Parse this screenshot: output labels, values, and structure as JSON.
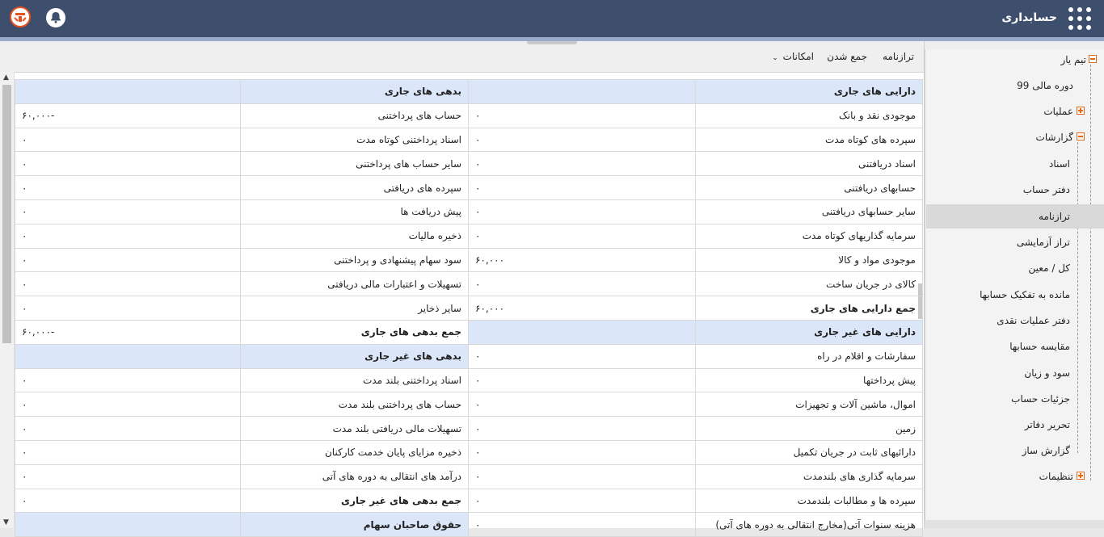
{
  "header": {
    "app_title": "حسابداری",
    "icons": [
      "apps-grid-icon",
      "bell-icon",
      "logo-icon"
    ]
  },
  "sidebar": {
    "items": [
      {
        "label": "تیم یار",
        "toggle": "minus"
      },
      {
        "label": "دوره مالی 99"
      },
      {
        "label": "عملیات",
        "toggle": "plus"
      },
      {
        "label": "گزارشات",
        "toggle": "minus"
      },
      {
        "label": "اسناد"
      },
      {
        "label": "دفتر حساب"
      },
      {
        "label": "ترازنامه",
        "active": true
      },
      {
        "label": "تراز آزمایشی"
      },
      {
        "label": "کل / معین"
      },
      {
        "label": "مانده به تفکیک حسابها"
      },
      {
        "label": "دفتر عملیات نقدی"
      },
      {
        "label": "مقایسه حسابها"
      },
      {
        "label": "سود و زیان"
      },
      {
        "label": "جزئیات حساب"
      },
      {
        "label": "تحریر دفاتر"
      },
      {
        "label": "گزارش ساز"
      },
      {
        "label": "تنظیمات",
        "toggle": "plus"
      }
    ]
  },
  "toolbar": {
    "title": "ترازنامه",
    "sum_label": "جمع شدن",
    "options_label": "امکانات"
  },
  "rows": [
    {
      "a_label": "دارایی های جاری",
      "a_value": "",
      "l_label": "بدهی های جاری",
      "l_value": "",
      "type": "header"
    },
    {
      "a_label": "موجودی نقد و بانک",
      "a_value": "۰",
      "l_label": "حساب های پرداختنی",
      "l_value": "-۶۰,۰۰۰"
    },
    {
      "a_label": "سپرده های کوتاه مدت",
      "a_value": "۰",
      "l_label": "اسناد پرداختنی کوتاه مدت",
      "l_value": "۰"
    },
    {
      "a_label": "اسناد دریافتنی",
      "a_value": "۰",
      "l_label": "سایر حساب های پرداختنی",
      "l_value": "۰"
    },
    {
      "a_label": "حسابهای دریافتنی",
      "a_value": "۰",
      "l_label": "سپرده های دریافتی",
      "l_value": "۰"
    },
    {
      "a_label": "سایر حسابهای دریافتنی",
      "a_value": "۰",
      "l_label": "پیش دریافت ها",
      "l_value": "۰"
    },
    {
      "a_label": "سرمایه گذاریهای کوتاه مدت",
      "a_value": "۰",
      "l_label": "ذخیره مالیات",
      "l_value": "۰"
    },
    {
      "a_label": "موجودی مواد و کالا",
      "a_value": "۶۰,۰۰۰",
      "l_label": "سود سهام پیشنهادی و پرداختنی",
      "l_value": "۰"
    },
    {
      "a_label": "کالای در جریان ساخت",
      "a_value": "۰",
      "l_label": "تسهیلات و اعتبارات مالی دریافتی",
      "l_value": "۰"
    },
    {
      "a_label": "جمع دارایی های جاری",
      "a_value": "۶۰,۰۰۰",
      "l_label": "سایر ذخایر",
      "l_value": "۰",
      "a_sum": true
    },
    {
      "a_label": "دارایی های غیر جاری",
      "a_value": "",
      "l_label": "جمع بدهی های جاری",
      "l_value": "-۶۰,۰۰۰",
      "a_header": true,
      "l_sum": true
    },
    {
      "a_label": "سفارشات و اقلام در راه",
      "a_value": "۰",
      "l_label": "بدهی های غیر جاری",
      "l_value": "",
      "l_header": true
    },
    {
      "a_label": "پیش پرداختها",
      "a_value": "۰",
      "l_label": "اسناد پرداختنی بلند مدت",
      "l_value": "۰"
    },
    {
      "a_label": "اموال، ماشین آلات و تجهیزات",
      "a_value": "۰",
      "l_label": "حساب های پرداختنی بلند مدت",
      "l_value": "۰"
    },
    {
      "a_label": "زمین",
      "a_value": "۰",
      "l_label": "تسهیلات مالی دریافتی بلند مدت",
      "l_value": "۰"
    },
    {
      "a_label": "دارائیهای ثابت در جریان تکمیل",
      "a_value": "۰",
      "l_label": "ذخیره مزایای پایان خدمت کارکنان",
      "l_value": "۰"
    },
    {
      "a_label": "سرمایه گذاری های بلندمدت",
      "a_value": "۰",
      "l_label": "درآمد های انتقالی به دوره های آتی",
      "l_value": "۰"
    },
    {
      "a_label": "سپرده ها و مطالبات بلندمدت",
      "a_value": "۰",
      "l_label": "جمع بدهی های غیر جاری",
      "l_value": "۰",
      "l_sum": true
    },
    {
      "a_label": "هزینه سنوات آتی(مخارج انتقالی به دوره های آتی)",
      "a_value": "۰",
      "l_label": "حقوق صاحبان سهام",
      "l_value": "",
      "l_header": true
    }
  ]
}
